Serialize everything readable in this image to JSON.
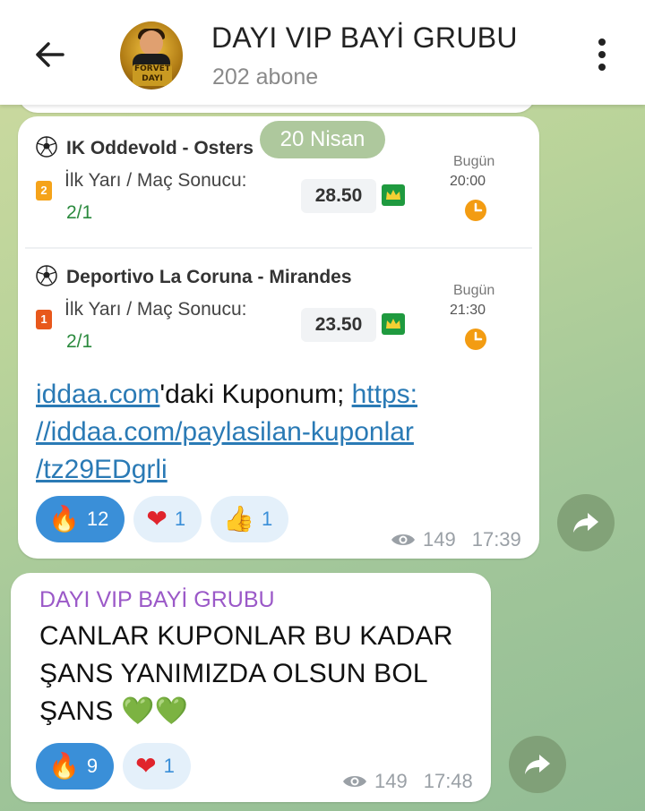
{
  "header": {
    "title": "DAYI VIP BAYİ GRUBU",
    "subtitle": "202 abone",
    "avatar_text": "FORVET DAYI"
  },
  "date_pill": "20 Nisan",
  "matches": [
    {
      "title": "IK Oddevold - Osters",
      "rank": "2",
      "bet_type": "İlk Yarı / Maç Sonucu:",
      "pick": "2/1",
      "odds": "28.50",
      "day": "Bugün",
      "time": "20:00"
    },
    {
      "title": "Deportivo La Coruna - Mirandes",
      "rank": "1",
      "bet_type": "İlk Yarı / Maç Sonucu:",
      "pick": "2/1",
      "odds": "23.50",
      "day": "Bugün",
      "time": "21:30"
    }
  ],
  "message1": {
    "link1": "iddaa.com",
    "text_mid": "'daki Kuponum; ",
    "link2": "https://iddaa.com/paylasilan-kuponlar/tz29EDgrli",
    "link2_line1": "https:",
    "link2_line2": "//iddaa.com/paylasilan-kuponlar",
    "link2_line3": "/tz29EDgrli",
    "reactions": [
      {
        "emoji": "🔥",
        "icon": "fire-icon",
        "count": "12",
        "active": true
      },
      {
        "emoji": "❤",
        "icon": "red-heart-icon",
        "count": "1",
        "active": false
      },
      {
        "emoji": "👍",
        "icon": "thumbs-up-icon",
        "count": "1",
        "active": false
      }
    ],
    "views": "149",
    "time": "17:39"
  },
  "message2": {
    "sender": "DAYI VIP BAYİ GRUBU",
    "text": "CANLAR KUPONLAR BU KADAR ŞANS YANIMIZDA OLSUN BOL ŞANS",
    "emojis": "💚💚",
    "reactions": [
      {
        "emoji": "🔥",
        "icon": "fire-icon",
        "count": "9",
        "active": true
      },
      {
        "emoji": "❤",
        "icon": "red-heart-icon",
        "count": "1",
        "active": false
      }
    ],
    "views": "149",
    "time": "17:48"
  },
  "colors": {
    "accent": "#3a8fd8",
    "link": "#2a7ab5",
    "sender": "#9b59c8",
    "pick_green": "#2b8a3e",
    "crown_green": "#1f9a3f",
    "clock_orange": "#f39c12"
  }
}
